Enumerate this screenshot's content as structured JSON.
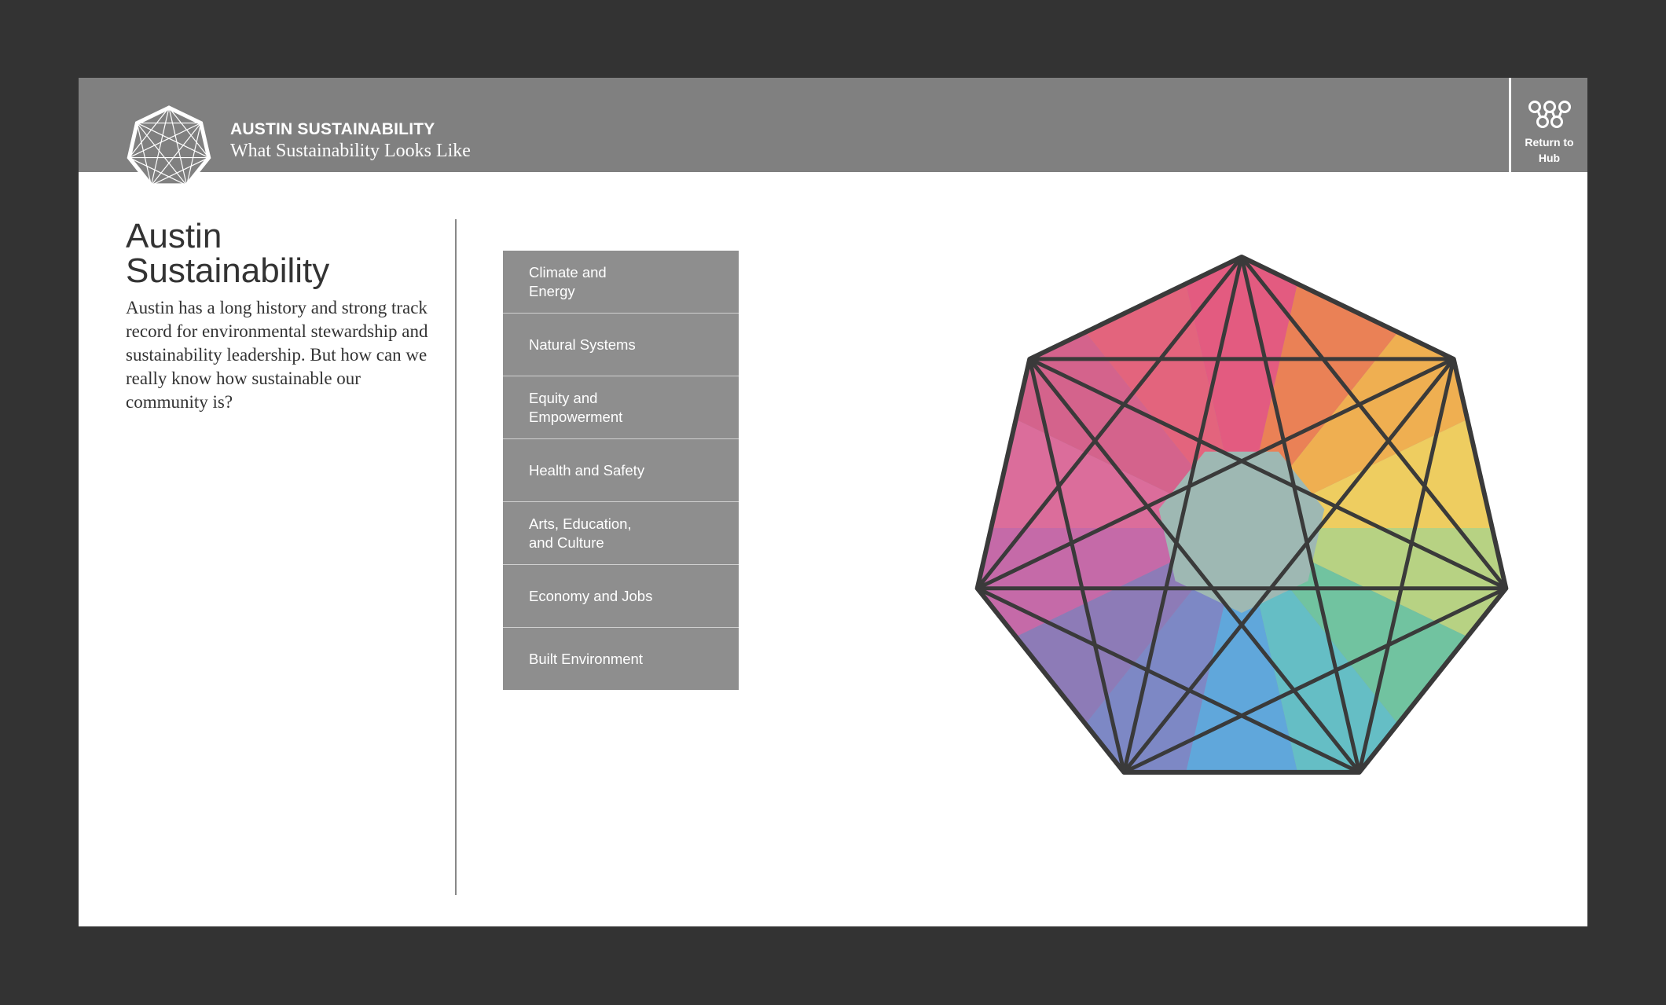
{
  "header": {
    "title": "AUSTIN SUSTAINABILITY",
    "subtitle": "What Sustainability Looks Like",
    "return_button": "Return to Hub"
  },
  "intro": {
    "title": "Austin Sustainability",
    "body": "Austin has a long history and strong track record for environmental stewardship and sustainability leadership. But how can we really know how sustainable our community is?"
  },
  "topics": [
    {
      "label": "Climate and Energy"
    },
    {
      "label": "Natural Systems"
    },
    {
      "label": "Equity and Empowerment"
    },
    {
      "label": "Health and Safety"
    },
    {
      "label": "Arts, Education, and Culture"
    },
    {
      "label": "Economy and Jobs"
    },
    {
      "label": "Built Environment"
    }
  ],
  "colors": {
    "frame": "#333333",
    "header_bg": "#808080",
    "topic_bg": "#8e8e8e",
    "text": "#333333",
    "star_palette": [
      "#e8577d",
      "#f3864f",
      "#f4c653",
      "#a8d87a",
      "#5cc6b6",
      "#5aa9e0",
      "#8b7ab8",
      "#c867a8"
    ]
  },
  "icons": {
    "logo": "heptagram-logo-icon",
    "hub": "hub-circles-icon"
  }
}
